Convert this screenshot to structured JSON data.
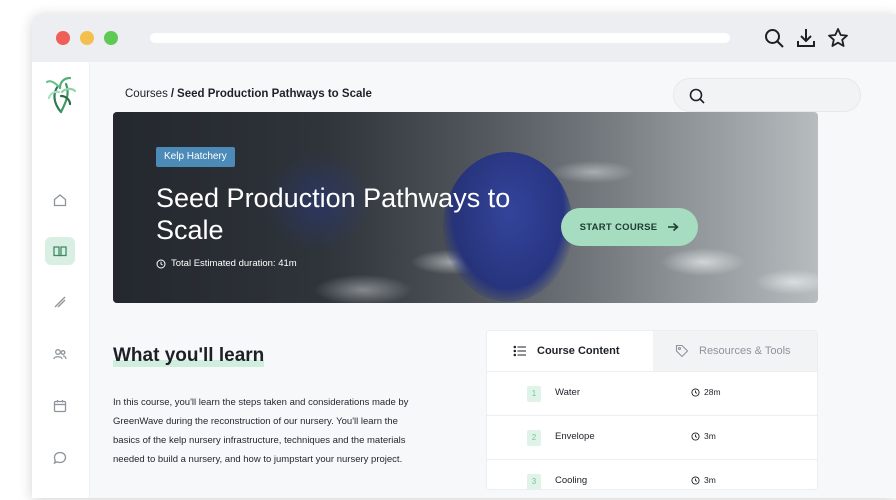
{
  "breadcrumb": {
    "root": "Courses",
    "separator": "/",
    "current": "Seed Production Pathways to Scale"
  },
  "hero": {
    "badge": "Kelp Hatchery",
    "title": "Seed Production Pathways to Scale",
    "duration": "Total Estimated duration: 41m",
    "cta": "START COURSE"
  },
  "learn": {
    "heading": "What you'll learn",
    "description": "In this course, you'll learn the steps taken and considerations made by GreenWave during the reconstruction of our nursery. You'll learn the basics of the kelp nursery infrastructure, techniques and the materials needed to build a nursery, and how to jumpstart your nursery project."
  },
  "panel": {
    "tabs": [
      {
        "label": "Course Content",
        "icon": "list-icon"
      },
      {
        "label": "Resources & Tools",
        "icon": "tag-icon"
      }
    ],
    "items": [
      {
        "number": "1",
        "title": "Water",
        "time": "28m"
      },
      {
        "number": "2",
        "title": "Envelope",
        "time": "3m"
      },
      {
        "number": "3",
        "title": "Cooling",
        "time": "3m"
      }
    ]
  },
  "colors": {
    "accent": "#a6ddc0",
    "badge": "#4c8ab8",
    "active_nav": "#d9efe3"
  }
}
